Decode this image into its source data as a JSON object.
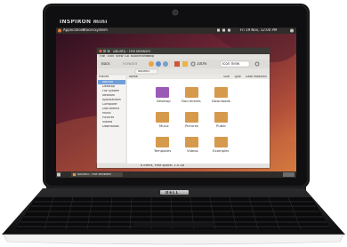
{
  "device": {
    "model_label": "INSPIRON mini",
    "brand_label": "DELL"
  },
  "desktop": {
    "top_panel": {
      "menus": [
        "Applications",
        "Places",
        "System"
      ],
      "clock": "Fri 19 Nov, 12:00 PM"
    },
    "bottom_panel": {
      "task": "ubuntu - File Browser"
    },
    "file_browser": {
      "title": "ubuntu - File Browser",
      "menubar": [
        "File",
        "Edit",
        "View",
        "Go",
        "Bookmarks",
        "Help"
      ],
      "toolbar": {
        "back_label": "Back",
        "forward_label": "Forward",
        "zoom_label": "100%",
        "view_mode": "Icon View"
      },
      "location": "ubuntu",
      "sidebar_header": "Places",
      "sidebar": [
        "ubuntu",
        "Desktop",
        "File System",
        "Network",
        "Applications",
        "Computer",
        "Documents",
        "Music",
        "Pictures",
        "Videos",
        "Downloads"
      ],
      "columns": [
        "Name",
        "Size",
        "Type",
        "Date Modified"
      ],
      "folders": [
        {
          "name": "Desktop",
          "icon": "desktop-folder"
        },
        {
          "name": "Documents",
          "icon": "documents-folder"
        },
        {
          "name": "Downloads",
          "icon": "downloads-folder"
        },
        {
          "name": "Music",
          "icon": "music-folder"
        },
        {
          "name": "Pictures",
          "icon": "pictures-folder"
        },
        {
          "name": "Public",
          "icon": "public-folder"
        },
        {
          "name": "Templates",
          "icon": "templates-folder"
        },
        {
          "name": "Videos",
          "icon": "videos-folder"
        },
        {
          "name": "Examples",
          "icon": "examples-folder"
        }
      ],
      "statusbar": "8 items, Free space: 2.0 GB"
    }
  },
  "colors": {
    "bezel": "#121214",
    "wallpaper_dark": "#3a1826",
    "wallpaper_mid": "#9a3a3a",
    "wallpaper_light": "#d77a3c",
    "folder": "#d69a4c",
    "panel": "#2a2826"
  }
}
